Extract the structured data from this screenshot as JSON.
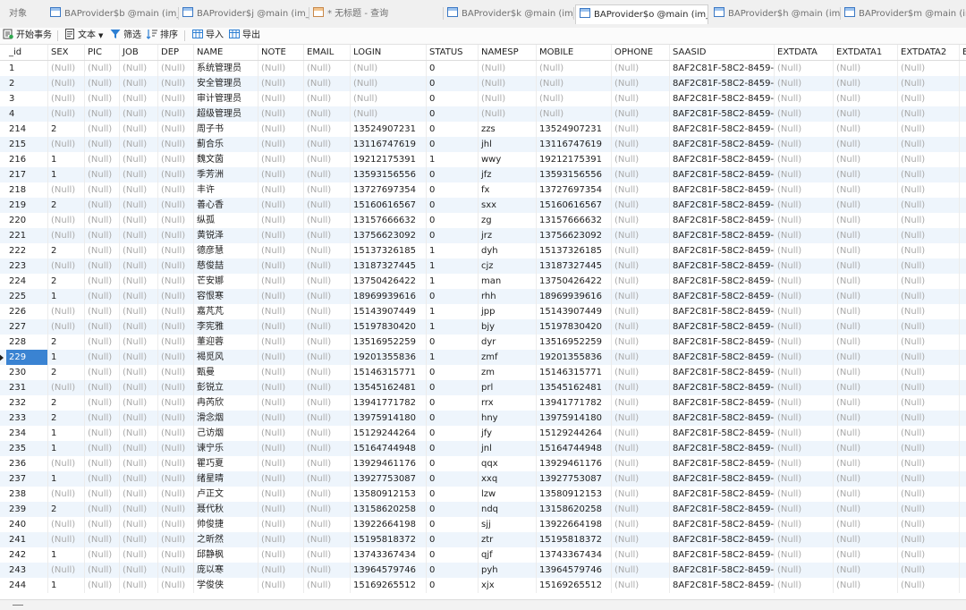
{
  "tabs": [
    {
      "label": "对象",
      "icon": "",
      "active": false
    },
    {
      "label": "BAProvider$b @main (im_...",
      "icon": "table-icon",
      "active": false
    },
    {
      "label": "BAProvider$j @main (im_...",
      "icon": "table-icon",
      "active": false
    },
    {
      "label": "* 无标题 - 查询",
      "icon": "query-icon",
      "active": false
    },
    {
      "label": "BAProvider$k @main (im_...",
      "icon": "table-icon",
      "active": false
    },
    {
      "label": "BAProvider$o @main (im_...",
      "icon": "table-icon",
      "active": true
    },
    {
      "label": "BAProvider$h @main (im_...",
      "icon": "table-icon",
      "active": false
    },
    {
      "label": "BAProvider$m @main (im_...",
      "icon": "table-icon",
      "active": false
    }
  ],
  "toolbar": {
    "begin_transaction": "开始事务",
    "text": "文本",
    "filter": "筛选",
    "sort": "排序",
    "import": "导入",
    "export": "导出"
  },
  "columns": [
    "_id",
    "SEX",
    "PIC",
    "JOB",
    "DEP",
    "NAME",
    "NOTE",
    "EMAIL",
    "LOGIN",
    "STATUS",
    "NAMESP",
    "MOBILE",
    "OPHONE",
    "SAASID",
    "EXTDATA",
    "EXTDATA1",
    "EXTDATA2",
    "E"
  ],
  "null_text": "(Null)",
  "saasid_text": "8AF2C81F-58C2-8459-C49",
  "rows": [
    {
      "id": "1",
      "sex": "",
      "name": "系统管理员",
      "login": "",
      "status": "0",
      "namesp": "",
      "mobile": ""
    },
    {
      "id": "2",
      "sex": "",
      "name": "安全管理员",
      "login": "",
      "status": "0",
      "namesp": "",
      "mobile": ""
    },
    {
      "id": "3",
      "sex": "",
      "name": "审计管理员",
      "login": "",
      "status": "0",
      "namesp": "",
      "mobile": ""
    },
    {
      "id": "4",
      "sex": "",
      "name": "超级管理员",
      "login": "",
      "status": "0",
      "namesp": "",
      "mobile": ""
    },
    {
      "id": "214",
      "sex": "2",
      "name": "周子书",
      "login": "13524907231",
      "status": "0",
      "namesp": "zzs",
      "mobile": "13524907231"
    },
    {
      "id": "215",
      "sex": "",
      "name": "蓟合乐",
      "login": "13116747619",
      "status": "0",
      "namesp": "jhl",
      "mobile": "13116747619"
    },
    {
      "id": "216",
      "sex": "1",
      "name": "魏文茵",
      "login": "19212175391",
      "status": "1",
      "namesp": "wwy",
      "mobile": "19212175391"
    },
    {
      "id": "217",
      "sex": "1",
      "name": "季芳洲",
      "login": "13593156556",
      "status": "0",
      "namesp": "jfz",
      "mobile": "13593156556"
    },
    {
      "id": "218",
      "sex": "",
      "name": "丰许",
      "login": "13727697354",
      "status": "0",
      "namesp": "fx",
      "mobile": "13727697354"
    },
    {
      "id": "219",
      "sex": "2",
      "name": "善心香",
      "login": "15160616567",
      "status": "0",
      "namesp": "sxx",
      "mobile": "15160616567"
    },
    {
      "id": "220",
      "sex": "",
      "name": "纵孤",
      "login": "13157666632",
      "status": "0",
      "namesp": "zg",
      "mobile": "13157666632"
    },
    {
      "id": "221",
      "sex": "",
      "name": "黄锐泽",
      "login": "13756623092",
      "status": "0",
      "namesp": "jrz",
      "mobile": "13756623092"
    },
    {
      "id": "222",
      "sex": "2",
      "name": "德彦慧",
      "login": "15137326185",
      "status": "1",
      "namesp": "dyh",
      "mobile": "15137326185"
    },
    {
      "id": "223",
      "sex": "",
      "name": "慈俊喆",
      "login": "13187327445",
      "status": "1",
      "namesp": "cjz",
      "mobile": "13187327445"
    },
    {
      "id": "224",
      "sex": "2",
      "name": "芒安娜",
      "login": "13750426422",
      "status": "1",
      "namesp": "man",
      "mobile": "13750426422"
    },
    {
      "id": "225",
      "sex": "1",
      "name": "容恨寒",
      "login": "18969939616",
      "status": "0",
      "namesp": "rhh",
      "mobile": "18969939616"
    },
    {
      "id": "226",
      "sex": "",
      "name": "嘉芃芃",
      "login": "15143907449",
      "status": "1",
      "namesp": "jpp",
      "mobile": "15143907449"
    },
    {
      "id": "227",
      "sex": "",
      "name": "李宪雅",
      "login": "15197830420",
      "status": "1",
      "namesp": "bjy",
      "mobile": "15197830420"
    },
    {
      "id": "228",
      "sex": "2",
      "name": "董迎蓉",
      "login": "13516952259",
      "status": "0",
      "namesp": "dyr",
      "mobile": "13516952259"
    },
    {
      "id": "229",
      "sex": "1",
      "name": "褐觅风",
      "login": "19201355836",
      "status": "1",
      "namesp": "zmf",
      "mobile": "19201355836"
    },
    {
      "id": "230",
      "sex": "2",
      "name": "甄曼",
      "login": "15146315771",
      "status": "0",
      "namesp": "zm",
      "mobile": "15146315771"
    },
    {
      "id": "231",
      "sex": "",
      "name": "彭锐立",
      "login": "13545162481",
      "status": "0",
      "namesp": "prl",
      "mobile": "13545162481"
    },
    {
      "id": "232",
      "sex": "2",
      "name": "冉芮欣",
      "login": "13941771782",
      "status": "0",
      "namesp": "rrx",
      "mobile": "13941771782"
    },
    {
      "id": "233",
      "sex": "2",
      "name": "滑念烟",
      "login": "13975914180",
      "status": "0",
      "namesp": "hny",
      "mobile": "13975914180"
    },
    {
      "id": "234",
      "sex": "1",
      "name": "己访烟",
      "login": "15129244264",
      "status": "0",
      "namesp": "jfy",
      "mobile": "15129244264"
    },
    {
      "id": "235",
      "sex": "1",
      "name": "谏宁乐",
      "login": "15164744948",
      "status": "0",
      "namesp": "jnl",
      "mobile": "15164744948"
    },
    {
      "id": "236",
      "sex": "",
      "name": "瞿巧夏",
      "login": "13929461176",
      "status": "0",
      "namesp": "qqx",
      "mobile": "13929461176"
    },
    {
      "id": "237",
      "sex": "1",
      "name": "绪星晴",
      "login": "13927753087",
      "status": "0",
      "namesp": "xxq",
      "mobile": "13927753087"
    },
    {
      "id": "238",
      "sex": "",
      "name": "卢正文",
      "login": "13580912153",
      "status": "0",
      "namesp": "lzw",
      "mobile": "13580912153"
    },
    {
      "id": "239",
      "sex": "2",
      "name": "聂代秋",
      "login": "13158620258",
      "status": "0",
      "namesp": "ndq",
      "mobile": "13158620258"
    },
    {
      "id": "240",
      "sex": "",
      "name": "帅俊捷",
      "login": "13922664198",
      "status": "0",
      "namesp": "sjj",
      "mobile": "13922664198"
    },
    {
      "id": "241",
      "sex": "",
      "name": "之昕然",
      "login": "15195818372",
      "status": "0",
      "namesp": "ztr",
      "mobile": "15195818372"
    },
    {
      "id": "242",
      "sex": "1",
      "name": "邱静枫",
      "login": "13743367434",
      "status": "0",
      "namesp": "qjf",
      "mobile": "13743367434"
    },
    {
      "id": "243",
      "sex": "",
      "name": "庞以寒",
      "login": "13964579746",
      "status": "0",
      "namesp": "pyh",
      "mobile": "13964579746"
    },
    {
      "id": "244",
      "sex": "1",
      "name": "学俊侠",
      "login": "15169265512",
      "status": "0",
      "namesp": "xjx",
      "mobile": "15169265512"
    }
  ],
  "selected_row_id": "229"
}
